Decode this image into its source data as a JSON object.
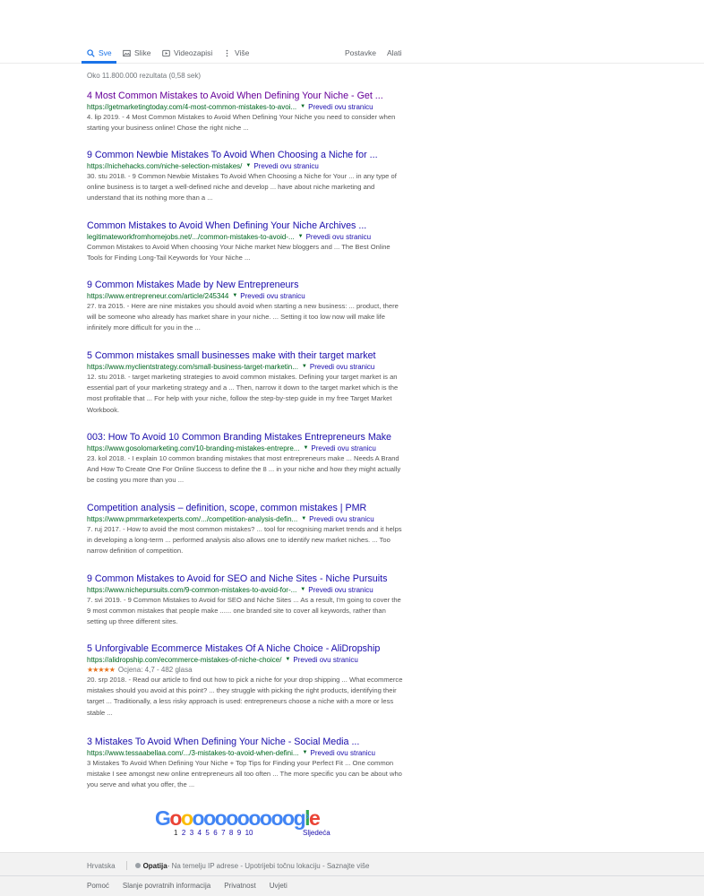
{
  "tabs": {
    "all": "Sve",
    "images": "Slike",
    "videos": "Videozapisi",
    "more": "Više",
    "settings": "Postavke",
    "tools": "Alati"
  },
  "stats": "Oko 11.800.000 rezultata (0,58 sek)",
  "translate_label": "Prevedi ovu stranicu",
  "results": [
    {
      "title": "4 Most Common Mistakes to Avoid When Defining Your Niche - Get ...",
      "url": "https://getmarketingtoday.com/4-most-common-mistakes-to-avoi...",
      "snippet": "4. lip 2019. - 4 Most Common Mistakes to Avoid When Defining Your Niche you need to consider when starting your business online! Chose the right niche ..."
    },
    {
      "title": "9 Common Newbie Mistakes To Avoid When Choosing a Niche for ...",
      "url": "https://nichehacks.com/niche-selection-mistakes/",
      "snippet": "30. stu 2018. - 9 Common Newbie Mistakes To Avoid When Choosing a Niche for Your ... in any type of online business is to target a well-defined niche and develop ... have about niche marketing and understand that its nothing more than a ..."
    },
    {
      "title": "Common Mistakes to Avoid When Defining Your Niche Archives ...",
      "url": "legitimateworkfromhomejobs.net/.../common-mistakes-to-avoid-...",
      "snippet": "Common Mistakes to Avoid When choosing Your Niche market New bloggers and ... The Best Online Tools for Finding Long-Tail Keywords for Your Niche ..."
    },
    {
      "title": "9 Common Mistakes Made by New Entrepreneurs",
      "url": "https://www.entrepreneur.com/article/245344",
      "snippet": "27. tra 2015. - Here are nine mistakes you should avoid when starting a new business: ... product, there will be someone who already has market share in your niche. ... Setting it too low now will make life infinitely more difficult for you in the ..."
    },
    {
      "title": "5 Common mistakes small businesses make with their target market",
      "url": "https://www.myclientstrategy.com/small-business-target-marketin...",
      "snippet": "12. stu 2018. - target marketing strategies to avoid common mistakes. Defining your target market is an essential part of your marketing strategy and a ... Then, narrow it down to the target market which is the most profitable that ... For help with your niche, follow the step-by-step guide in my free Target Market Workbook."
    },
    {
      "title": "003: How To Avoid 10 Common Branding Mistakes Entrepreneurs Make",
      "url": "https://www.gosolomarketing.com/10-branding-mistakes-entrepre...",
      "snippet": "23. kol 2018. - I explain 10 common branding mistakes that most entrepreneurs make ... Needs A Brand And How To Create One For Online Success to define the 8 ... in your niche and how they might actually be costing you more than you ..."
    },
    {
      "title": "Competition analysis – definition, scope, common mistakes | PMR",
      "url": "https://www.pmrmarketexperts.com/.../competition-analysis-defin...",
      "snippet": "7. ruj 2017. - How to avoid the most common mistakes? ... tool for recognising market trends and it helps in developing a long-term ... performed analysis also allows one to identify new market niches. ... Too narrow definition of competition."
    },
    {
      "title": "9 Common Mistakes to Avoid for SEO and Niche Sites - Niche Pursuits",
      "url": "https://www.nichepursuits.com/9-common-mistakes-to-avoid-for-...",
      "snippet": "7. svi 2019. - 9 Common Mistakes to Avoid for SEO and Niche Sites ... As a result, I'm going to cover the 9 most common mistakes that people make ...... one branded site to cover all keywords, rather than setting up three different sites."
    },
    {
      "title": "5 Unforgivable Ecommerce Mistakes Of A Niche Choice - AliDropship",
      "url": "https://alidropship.com/ecommerce-mistakes-of-niche-choice/",
      "rating": {
        "stars": "★★★★★",
        "value": 4.7,
        "text": "Ocjena: 4,7 - 482 glasa"
      },
      "snippet": "20. srp 2018. - Read our article to find out how to pick a niche for your drop shipping ... What ecommerce mistakes should you avoid at this point? ... they struggle with picking the right products, identifying their target ... Traditionally, a less risky approach is used: entrepreneurs choose a niche with a more or less stable ..."
    },
    {
      "title": "3 Mistakes To Avoid When Defining Your Niche - Social Media ...",
      "url": "https://www.tessaabellaa.com/.../3-mistakes-to-avoid-when-defini...",
      "snippet": "3 Mistakes To Avoid When Defining Your Niche + Top Tips for Finding your Perfect Fit ... One common mistake I see amongst new online entrepreneurs all too often ... The more specific you can be about who you serve and what you offer, the ..."
    }
  ],
  "pagination": {
    "logo_letters": [
      "G",
      "o",
      "o",
      "o",
      "o",
      "o",
      "o",
      "o",
      "o",
      "o",
      "o",
      "o",
      "g",
      "l",
      "e"
    ],
    "logo_colors": [
      "#4285f4",
      "#ea4335",
      "#fbbc05",
      "#4285f4",
      "#4285f4",
      "#4285f4",
      "#4285f4",
      "#4285f4",
      "#4285f4",
      "#4285f4",
      "#4285f4",
      "#4285f4",
      "#4285f4",
      "#34a853",
      "#ea4335"
    ],
    "pages": [
      "1",
      "2",
      "3",
      "4",
      "5",
      "6",
      "7",
      "8",
      "9",
      "10"
    ],
    "current": "1",
    "next_label": "Sljedeća"
  },
  "footer": {
    "language": "Hrvatska",
    "location_name": "Opatija",
    "location_rest": " - Na temelju IP adrese - Upotrijebi točnu lokaciju - Saznajte više",
    "links": [
      "Pomoć",
      "Slanje povratnih informacija",
      "Privatnost",
      "Uvjeti"
    ]
  }
}
